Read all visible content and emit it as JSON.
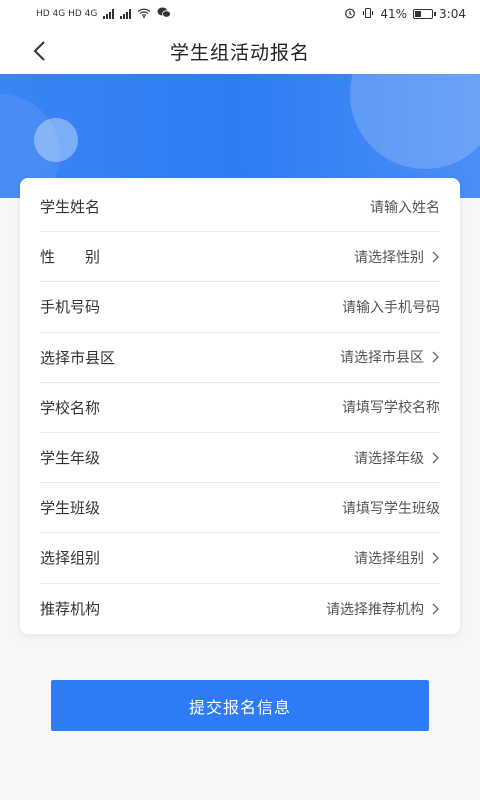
{
  "status_bar": {
    "left_text": "HD 4G HD 4G",
    "battery_percent": "41%",
    "time": "3:04"
  },
  "nav": {
    "title": "学生组活动报名",
    "back_icon": "chevron-left-icon"
  },
  "form": {
    "rows": [
      {
        "label": "学生姓名",
        "value": "请输入姓名",
        "has_arrow": false
      },
      {
        "label": "性　　别",
        "value": "请选择性别",
        "has_arrow": true
      },
      {
        "label": "手机号码",
        "value": "请输入手机号码",
        "has_arrow": false
      },
      {
        "label": "选择市县区",
        "value": "请选择市县区",
        "has_arrow": true
      },
      {
        "label": "学校名称",
        "value": "请填写学校名称",
        "has_arrow": false
      },
      {
        "label": "学生年级",
        "value": "请选择年级",
        "has_arrow": true
      },
      {
        "label": "学生班级",
        "value": "请填写学生班级",
        "has_arrow": false
      },
      {
        "label": "选择组别",
        "value": "请选择组别",
        "has_arrow": true
      },
      {
        "label": "推荐机构",
        "value": "请选择推荐机构",
        "has_arrow": true
      }
    ]
  },
  "submit_label": "提交报名信息",
  "colors": {
    "accent": "#2d7cf6",
    "banner": "#3a84f4",
    "background": "#f6f7f9"
  }
}
